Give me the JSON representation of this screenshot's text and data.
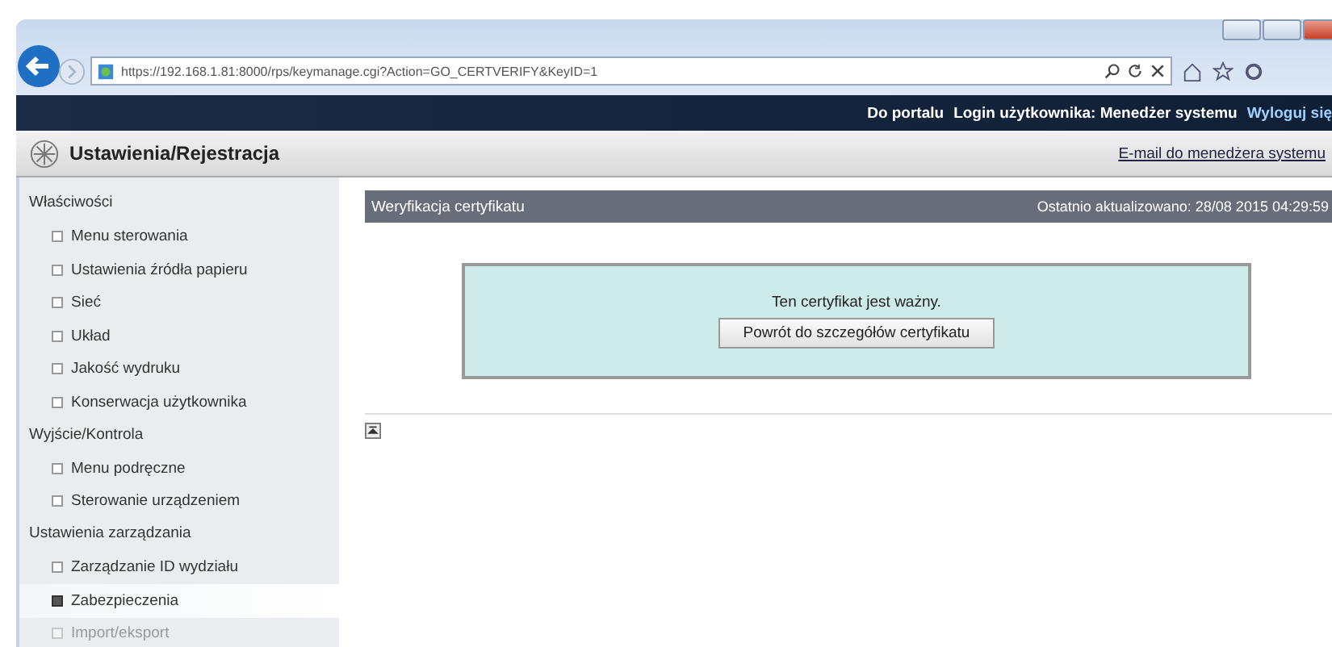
{
  "browser": {
    "url": "https://192.168.1.81:8000/rps/keymanage.cgi?Action=GO_CERTVERIFY&KeyID=1"
  },
  "topbar": {
    "links": [
      "Do portalu",
      "Login użytkownika: Menedżer systemu",
      "Wyloguj się"
    ]
  },
  "header": {
    "title": "Ustawienia/Rejestracja",
    "email_link": "E-mail do menedżera systemu"
  },
  "sidebar": {
    "sections": [
      {
        "title": "Właściwości",
        "items": [
          {
            "label": "Menu sterowania",
            "selected": false
          },
          {
            "label": "Ustawienia źródła papieru",
            "selected": false
          },
          {
            "label": "Sieć",
            "selected": false
          },
          {
            "label": "Układ",
            "selected": false
          },
          {
            "label": "Jakość wydruku",
            "selected": false
          },
          {
            "label": "Konserwacja użytkownika",
            "selected": false
          }
        ]
      },
      {
        "title": "Wyjście/Kontrola",
        "items": [
          {
            "label": "Menu podręczne",
            "selected": false
          },
          {
            "label": "Sterowanie urządzeniem",
            "selected": false
          }
        ]
      },
      {
        "title": "Ustawienia zarządzania",
        "items": [
          {
            "label": "Zarządzanie ID wydziału",
            "selected": false
          },
          {
            "label": "Zabezpieczenia",
            "selected": true
          },
          {
            "label": "Import/eksport",
            "selected": false
          }
        ]
      }
    ]
  },
  "panel": {
    "title": "Weryfikacja certyfikatu",
    "updated": "Ostatnio aktualizowano: 28/08 2015 04:29:59",
    "message": "Ten certyfikat jest ważny.",
    "button": "Powrót do szczegółów certyfikatu"
  }
}
